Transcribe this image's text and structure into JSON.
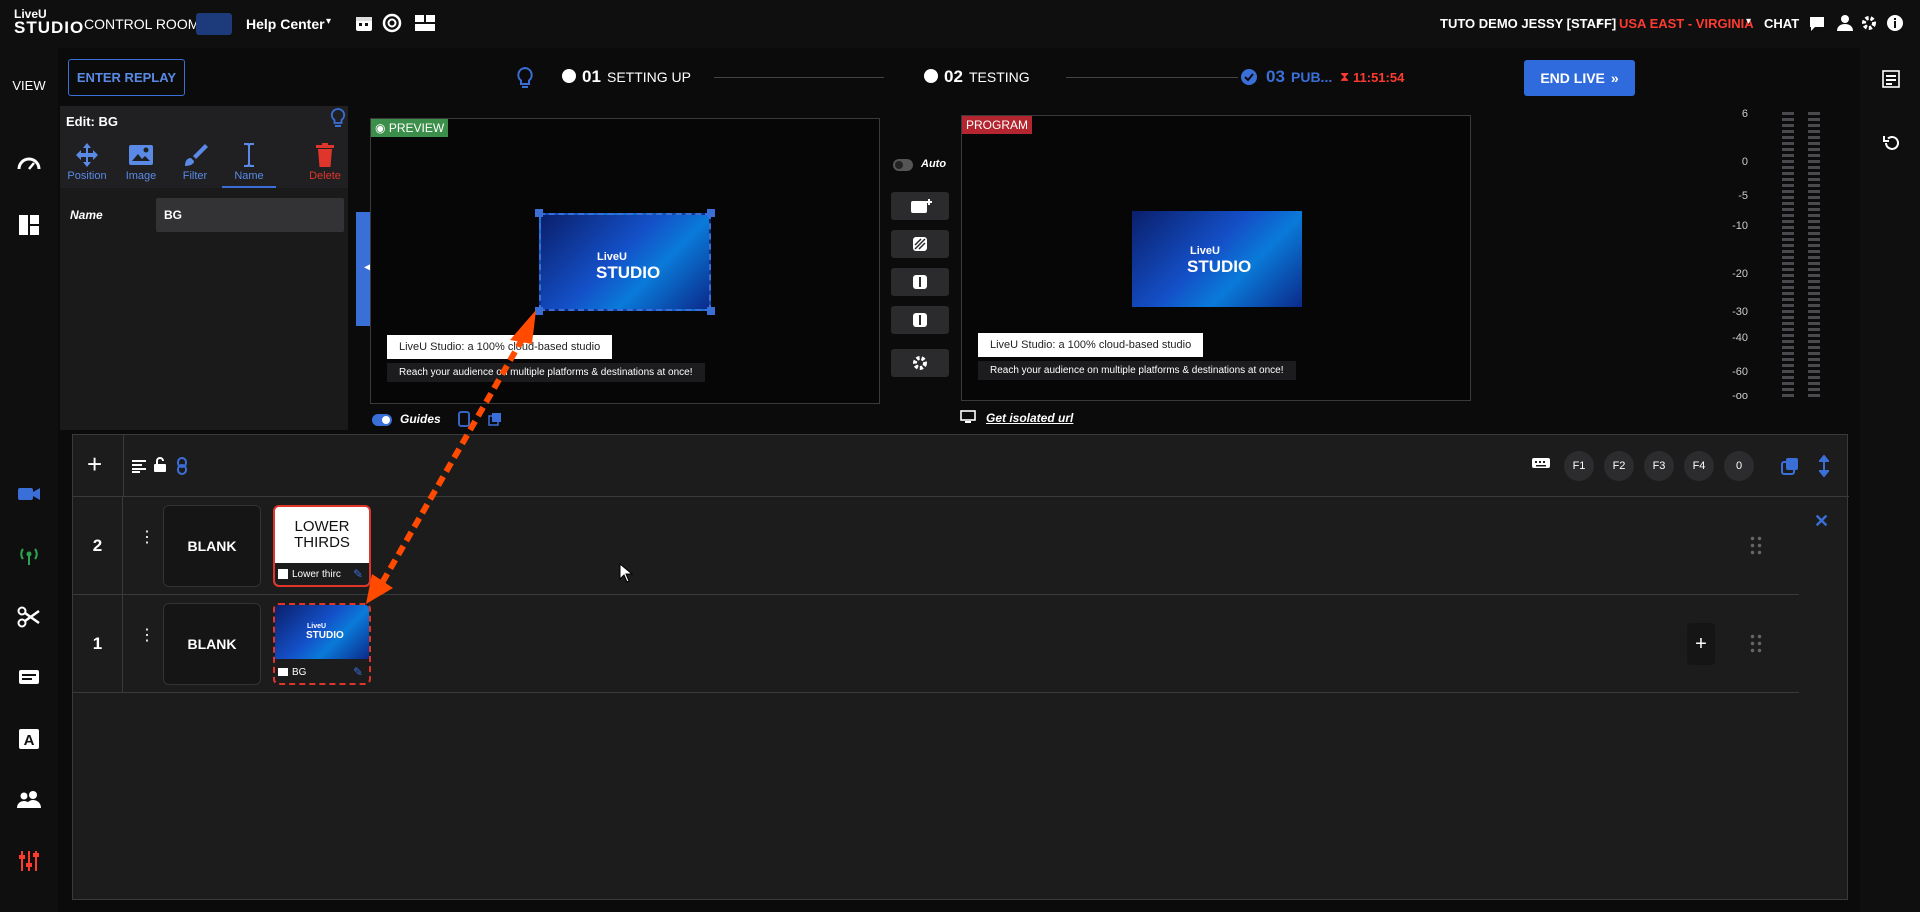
{
  "topbar": {
    "logo_line1": "LiveU",
    "logo_line2": "STUDIO",
    "control_rooms": "CONTROL ROOMS",
    "room_name": "Help Center",
    "user": "TUTO DEMO JESSY [STAFF]",
    "region": "USA EAST - VIRGINIA",
    "chat": "CHAT"
  },
  "leftrail": {
    "view_label": "VIEW"
  },
  "replay": {
    "label": "ENTER REPLAY"
  },
  "steps": [
    {
      "num": "01",
      "label": "SETTING UP"
    },
    {
      "num": "02",
      "label": "TESTING"
    },
    {
      "num": "03",
      "label": "PUB..."
    }
  ],
  "timer": "11:51:54",
  "end_live": {
    "label": "END LIVE"
  },
  "edit_panel": {
    "title": "Edit: BG",
    "tools": [
      {
        "label": "Position",
        "icon": "move-icon"
      },
      {
        "label": "Image",
        "icon": "image-icon"
      },
      {
        "label": "Filter",
        "icon": "brush-icon"
      },
      {
        "label": "Name",
        "icon": "text-cursor-icon"
      },
      {
        "label": "Delete",
        "icon": "trash-icon"
      }
    ],
    "active_tool": "Name",
    "name_label": "Name",
    "name_value": "BG"
  },
  "preview": {
    "tag": "PREVIEW",
    "lower_third_title": "LiveU Studio: a 100% cloud-based studio",
    "lower_third_sub": "Reach your audience on multiple platforms & destinations at once!",
    "guides_label": "Guides",
    "thumb_line1": "LiveU",
    "thumb_line2": "STUDIO"
  },
  "program": {
    "tag": "PROGRAM",
    "lower_third_title": "LiveU Studio: a 100% cloud-based studio",
    "lower_third_sub": "Reach your audience on multiple platforms & destinations at once!",
    "isolated_url": "Get isolated url",
    "thumb_line1": "LiveU",
    "thumb_line2": "STUDIO"
  },
  "switcher": {
    "auto_label": "Auto"
  },
  "meter": {
    "ticks": [
      "6",
      "0",
      "-5",
      "-10",
      "-20",
      "-30",
      "-40",
      "-60",
      "-oo"
    ]
  },
  "scenes": {
    "fkeys": [
      "F1",
      "F2",
      "F3",
      "F4",
      "0"
    ],
    "rows": [
      {
        "num": "2",
        "blank": "BLANK",
        "item_title_1": "LOWER",
        "item_title_2": "THIRDS",
        "item_label": "Lower thirc"
      },
      {
        "num": "1",
        "blank": "BLANK",
        "item_label": "BG",
        "thumb_line1": "LiveU",
        "thumb_line2": "STUDIO"
      }
    ]
  },
  "colors": {
    "accent": "#3a6fd8",
    "live_red": "#ff3b30",
    "arrow": "#ff4a00"
  }
}
